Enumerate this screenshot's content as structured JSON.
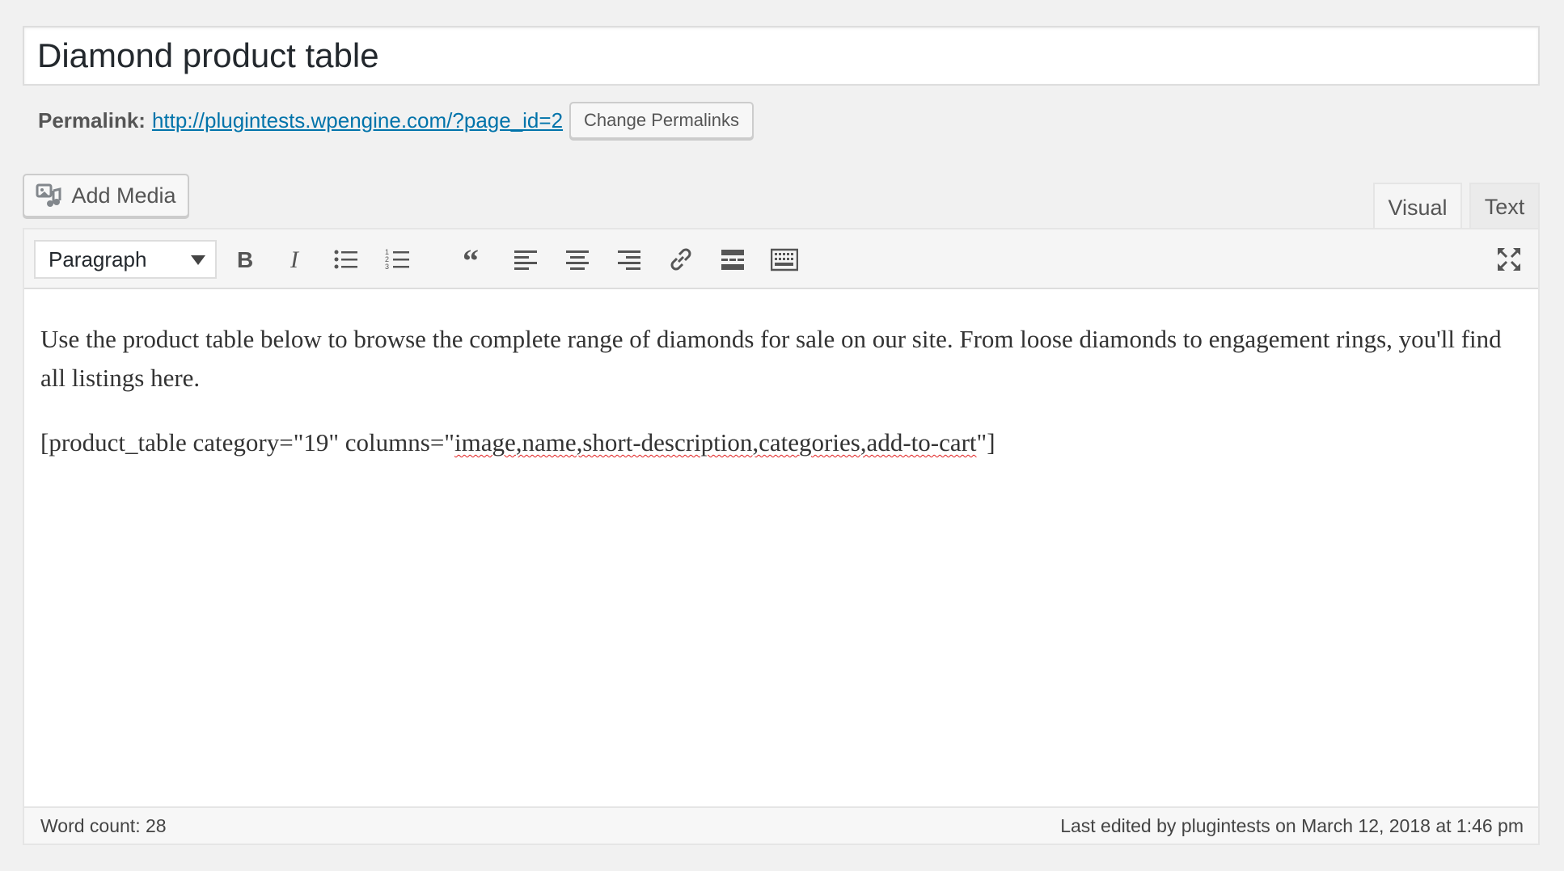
{
  "title": {
    "value": "Diamond product table"
  },
  "permalink": {
    "label": "Permalink:",
    "url": "http://plugintests.wpengine.com/?page_id=2",
    "change_button": "Change Permalinks"
  },
  "media": {
    "add_label": "Add Media",
    "icon": "media-add-icon"
  },
  "tabs": {
    "visual": "Visual",
    "text": "Text",
    "active": "visual"
  },
  "toolbar": {
    "format_value": "Paragraph",
    "buttons": [
      "bold-icon",
      "italic-icon",
      "bullet-list-icon",
      "numbered-list-icon",
      "blockquote-icon",
      "align-left-icon",
      "align-center-icon",
      "align-right-icon",
      "link-icon",
      "read-more-icon",
      "toolbar-toggle-icon"
    ],
    "fullscreen_icon": "fullscreen-icon"
  },
  "content": {
    "paragraph1": "Use the product table below to browse the complete range of diamonds for sale on our site. From loose diamonds to engagement rings, you'll find all listings here.",
    "shortcode_prefix": "[product_table category=\"19\" columns=\"",
    "shortcode_misspelled": "image,name,short-description,categories,add-to-cart",
    "shortcode_suffix": "\"]"
  },
  "status": {
    "word_count": "Word count: 28",
    "last_edited": "Last edited by plugintests on March 12, 2018 at 1:46 pm"
  },
  "colors": {
    "link": "#0073aa",
    "background": "#f1f1f1",
    "spellcheck": "#e02020"
  }
}
